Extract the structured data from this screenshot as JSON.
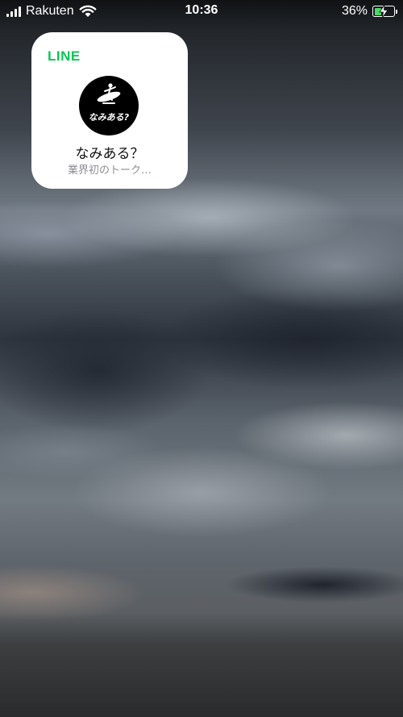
{
  "status_bar": {
    "carrier": "Rakuten",
    "time": "10:36",
    "battery_percent": "36%",
    "battery_level": 0.36,
    "charging": true,
    "icons": [
      "signal-icon",
      "wifi-icon",
      "battery-icon",
      "charging-bolt-icon"
    ]
  },
  "widget": {
    "app_name": "LINE",
    "app_color": "#06C755",
    "avatar_text": "なみある?",
    "title": "なみある？",
    "subtitle": "業界初のトーク…"
  }
}
